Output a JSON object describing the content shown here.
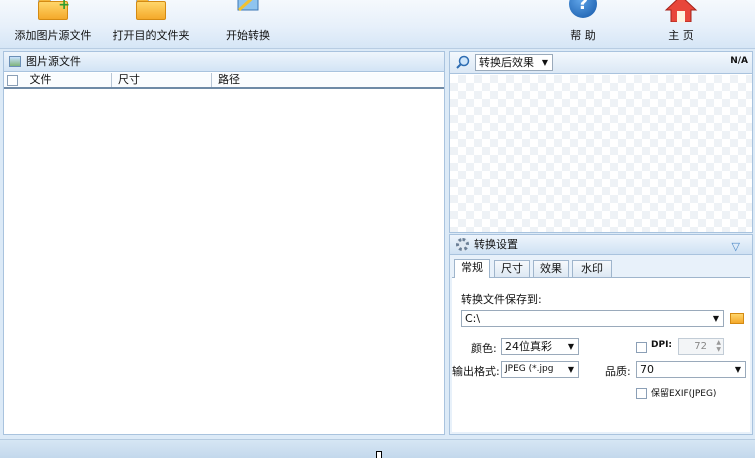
{
  "toolbar": {
    "add_source": "添加图片源文件",
    "open_target": "打开目的文件夹",
    "start_convert": "开始转换",
    "help": "帮 助",
    "home": "主 页"
  },
  "file_panel": {
    "title": "图片源文件",
    "columns": [
      "文件",
      "尺寸",
      "路径"
    ]
  },
  "preview": {
    "mode_select": "转换后效果",
    "status": "N/A"
  },
  "settings": {
    "title": "转换设置",
    "tabs": [
      "常规",
      "尺寸",
      "效果",
      "水印"
    ],
    "active_tab": "常规",
    "save_to_label": "转换文件保存到:",
    "save_path": "C:\\",
    "color_label": "颜色:",
    "color_value": "24位真彩",
    "dpi_label": "DPI:",
    "dpi_value": "72",
    "format_label": "输出格式:",
    "format_value": "JPEG (*.jpg",
    "quality_label": "品质:",
    "quality_value": "70",
    "exif_label": "保留EXIF(JPEG)"
  },
  "colors": {
    "toolbar_bg": "#e7f0fa",
    "panel_border": "#a9c3de",
    "accent": "#4a86c5"
  }
}
